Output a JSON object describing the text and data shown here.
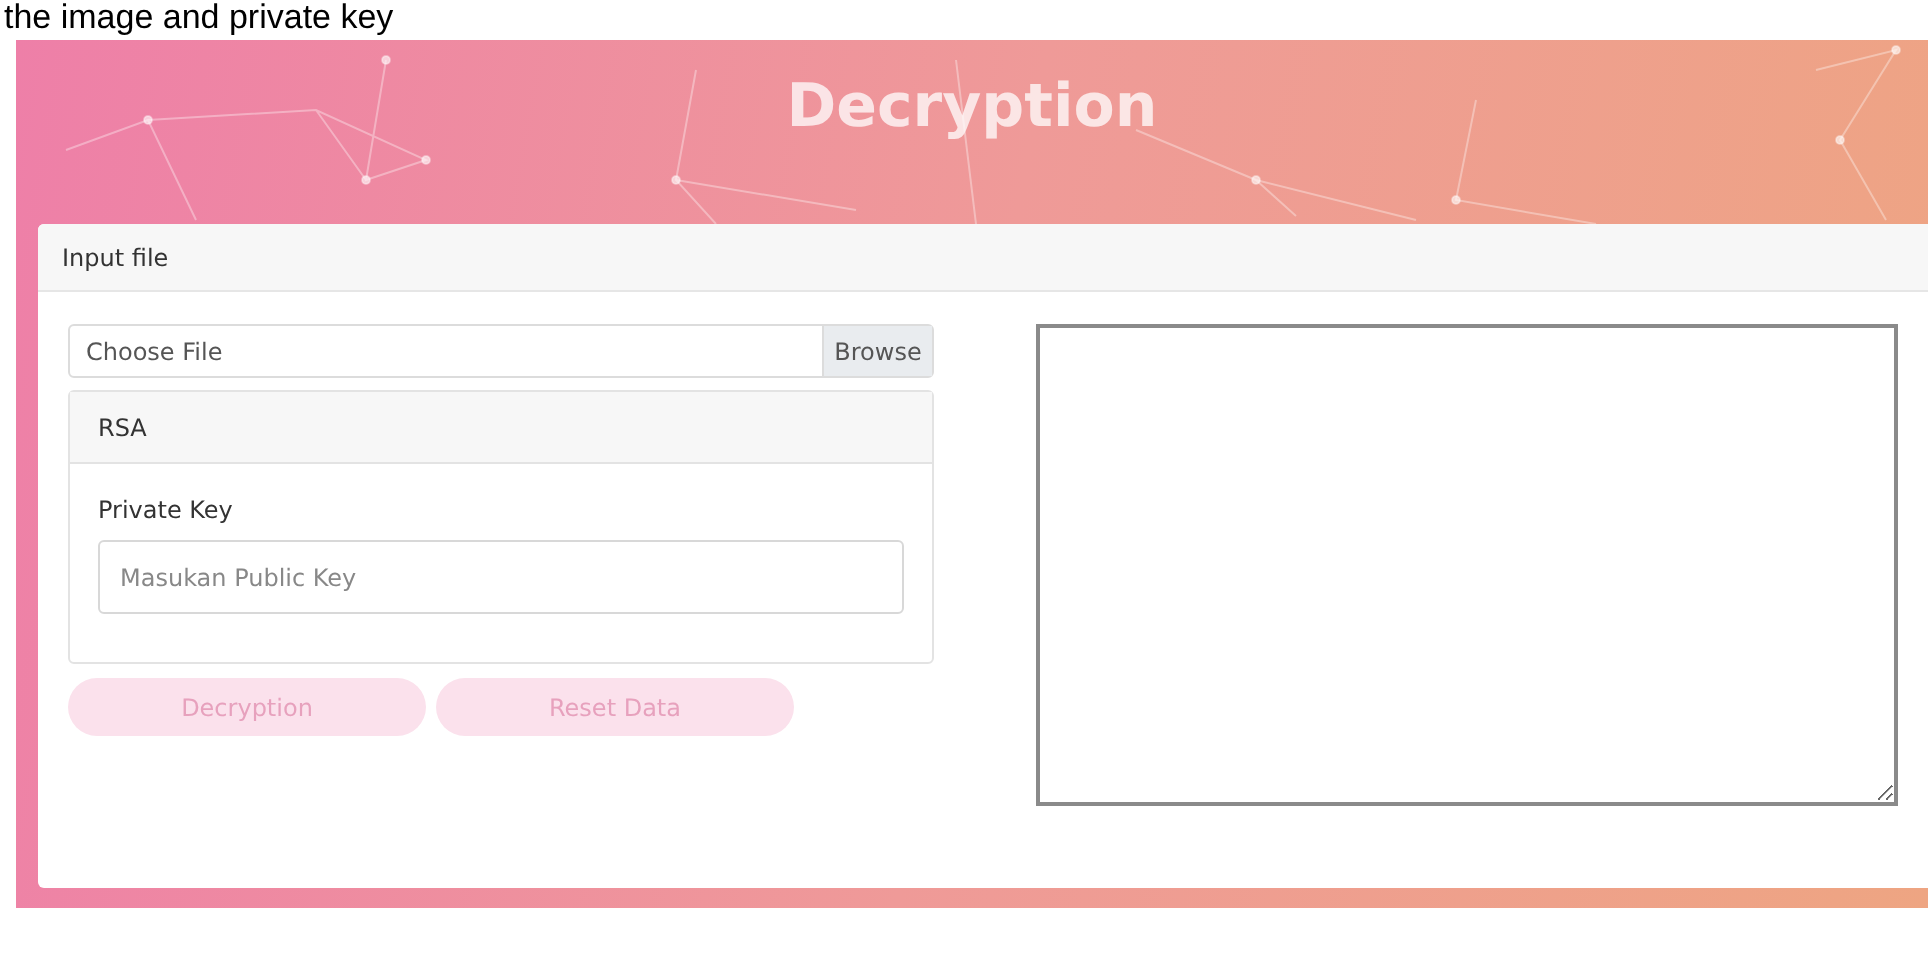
{
  "caption": "the image and private key",
  "header": {
    "title": "Decryption"
  },
  "card": {
    "title": "Input file",
    "file_input": {
      "placeholder": "Choose File",
      "button": "Browse"
    },
    "rsa_panel": {
      "title": "RSA",
      "field_label": "Private Key",
      "placeholder": "Masukan Public Key"
    },
    "buttons": [
      {
        "label": "Decryption",
        "disabled": true
      },
      {
        "label": "Reset Data",
        "disabled": true
      }
    ]
  }
}
